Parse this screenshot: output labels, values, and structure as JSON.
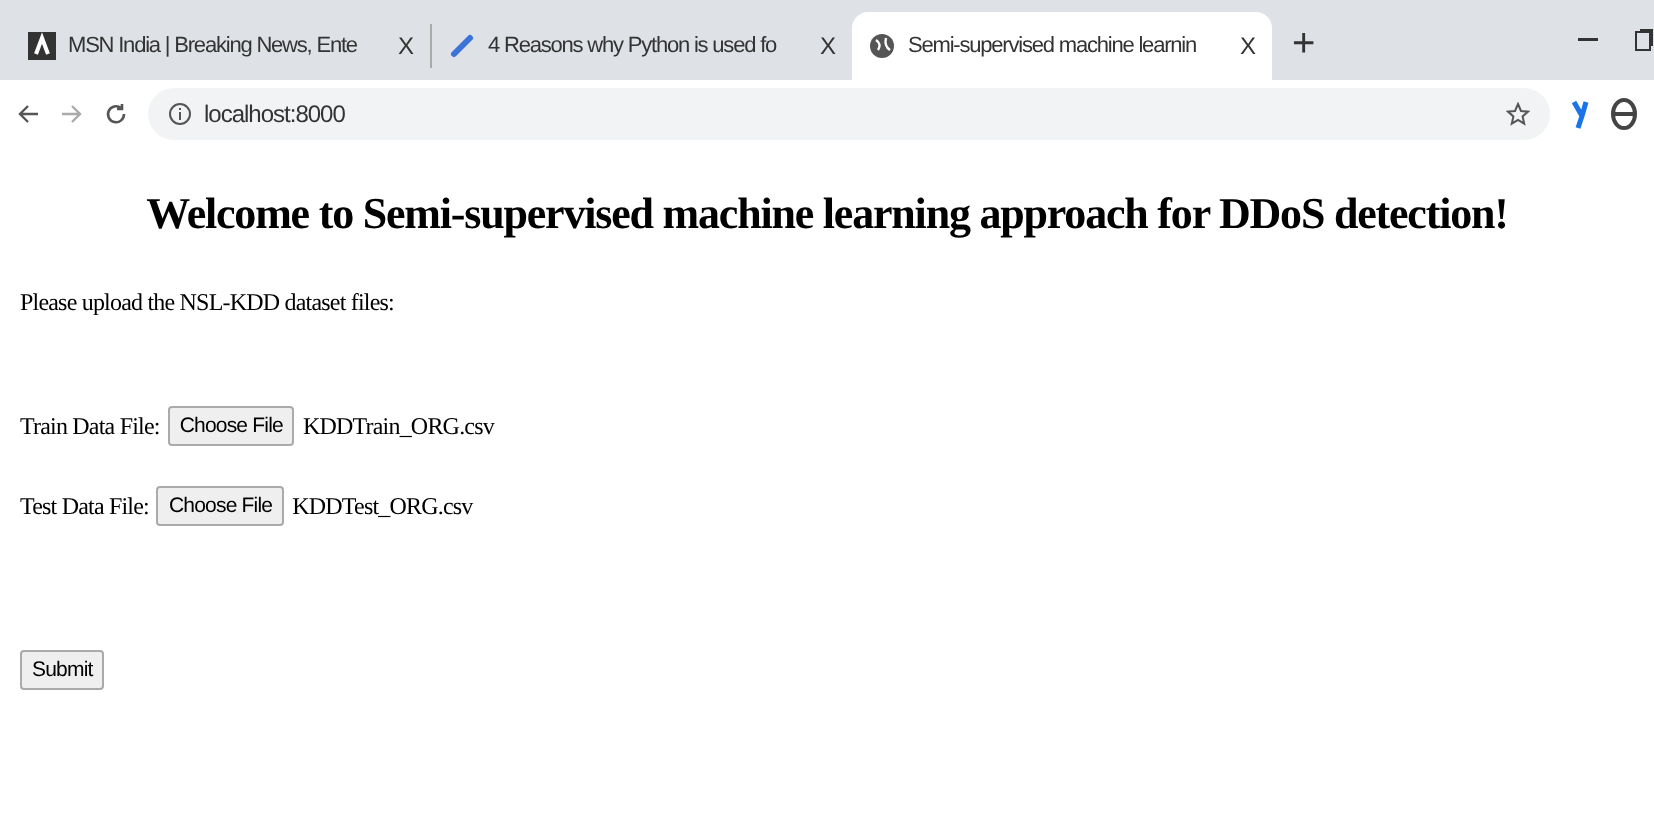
{
  "tabs": [
    {
      "title": "MSN India | Breaking News, Ente",
      "close": "X",
      "selected": false
    },
    {
      "title": "4 Reasons why Python is used fo",
      "close": "X",
      "selected": false
    },
    {
      "title": "Semi-supervised machine learnin",
      "close": "X",
      "selected": true
    }
  ],
  "new_tab": "+",
  "address_bar": {
    "url": "localhost:8000"
  },
  "page": {
    "heading": "Welcome to Semi-supervised machine learning approach for DDoS detection!",
    "intro": "Please upload the NSL-KDD dataset files:",
    "file_fields": [
      {
        "label": "Train Data File:",
        "button": "Choose File",
        "file_name": "KDDTrain_ORG.csv"
      },
      {
        "label": "Test Data File:",
        "button": "Choose File",
        "file_name": "KDDTest_ORG.csv"
      }
    ],
    "submit": "Submit"
  }
}
